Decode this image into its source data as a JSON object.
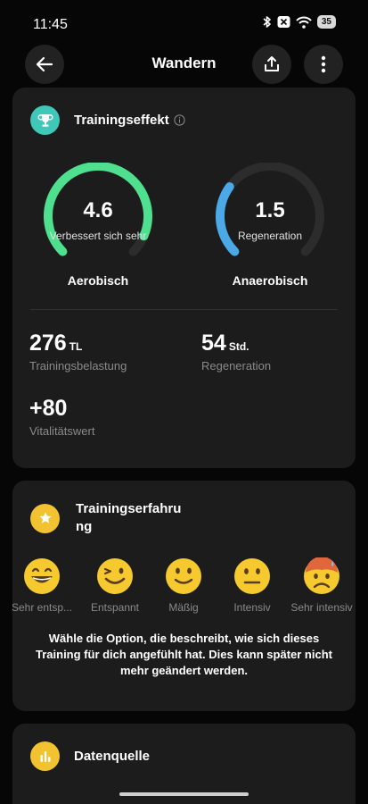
{
  "status_bar": {
    "time": "11:45",
    "battery": "35",
    "icons": [
      "bluetooth-icon",
      "notification-muted-icon",
      "wifi-icon",
      "battery-icon"
    ]
  },
  "header": {
    "title": "Wandern",
    "back_icon": "arrow-left-icon",
    "share_icon": "share-icon",
    "more_icon": "more-vertical-icon"
  },
  "training_effect": {
    "title": "Trainingseffekt",
    "icon": "trophy-icon",
    "info_icon": "info-icon",
    "aerobic": {
      "value": "4.6",
      "sub": "Verbessert sich sehr",
      "label": "Aerobisch",
      "level": 0.92,
      "color": "#4fe08f"
    },
    "anaerobic": {
      "value": "1.5",
      "sub": "Regeneration",
      "label": "Anaerobisch",
      "level": 0.3,
      "color": "#4aa9e6"
    },
    "stats": [
      {
        "value": "276",
        "unit": "TL",
        "label": "Trainingsbelastung"
      },
      {
        "value": "54",
        "unit": "Std.",
        "label": "Regeneration"
      },
      {
        "value": "+80",
        "unit": "",
        "label": "Vitalitätswert"
      }
    ]
  },
  "experience": {
    "title_line1": "Trainingserfahru",
    "title_line2": "ng",
    "icon": "star-icon",
    "options": [
      {
        "label": "Sehr entsp...",
        "icon": "grinning-face-icon"
      },
      {
        "label": "Entspannt",
        "icon": "winking-face-icon"
      },
      {
        "label": "Mäßig",
        "icon": "slightly-smiling-face-icon"
      },
      {
        "label": "Intensiv",
        "icon": "neutral-face-icon"
      },
      {
        "label": "Sehr intensiv",
        "icon": "hot-sweating-face-icon"
      }
    ],
    "hint": "Wähle die Option, die beschreibt, wie sich dieses Training für dich angefühlt hat. Dies kann später nicht mehr geändert werden."
  },
  "data_source": {
    "title": "Datenquelle",
    "icon": "bar-chart-icon"
  },
  "colors": {
    "trophy_bg": "#3fc7b8",
    "star_bg": "#f2c230",
    "source_bg": "#f2c230",
    "gauge_track": "#2c2c2c"
  }
}
